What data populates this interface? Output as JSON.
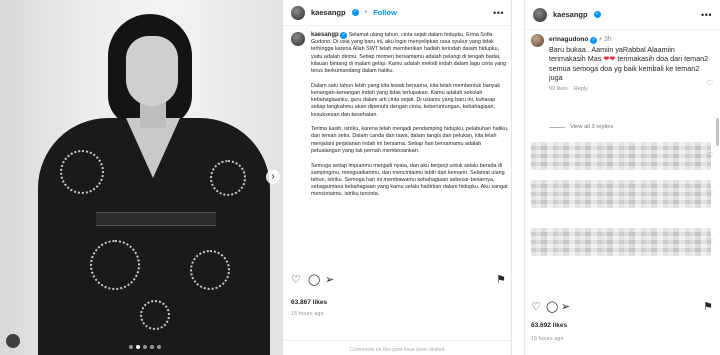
{
  "post_left": {
    "username": "kaesangp",
    "follow_label": "Follow",
    "more_label": "•••",
    "caption_username": "kaesangp",
    "caption_paragraphs": [
      "Selamat ulang tahun, cinta sejati dalam hidupku, Erina Sofia Gudono. Di usia yang baru ini, aku ingin menyelipkan rasa syukur yang tidak terhingga karena Allah SWT telah memberikan hadiah terindah dalam hidupku, yaitu adalah dirimu. Setiap momen bersamamu adalah pelangi di tengah badai, kilauan bintang di malam gelap. Kamu adalah melodi indah dalam lagu cinta yang terus berkumandang dalam hatiku.",
      "Dalam satu tahun lebih yang kita lewati bersama, kita telah membentuk banyak kenangan-kenangan indah yang tidak terlupakan. Kamu adalah sekolah kebahagiaanku, guru dalam arti cinta sejati. Di usiamu yang baru ini, kuharap setiap langkahmu akan dipenuhi dengan cinta, keberuntungan, kebahagiaan, kesuksesan dan kesehatan.",
      "Terima kasih, istriku, karena telah menjadi pendamping hidupku, pelabuhan hatiku, dan teman setia. Dalam canda dan tawa, dalam tangis dan pelukan, kita telah menjalani perjalanan indah ini bersama. Setiap hari bersamamu adalah petualangan yang tak pernah membosankan.",
      "Semoga setiap impianmu menjadi nyata, dan aku berjanji untuk selalu berada di sampingmu, menguatkanmu, dan mencintaimu lebih dari kemarin. Selamat ulang tahun, istriku. Semoga hari ini membawamu kebahagiaan sebesar-besarnya, sebagaimana kebahagiaan yang kamu selalu hadirkan dalam hidupku. Aku sangat mencintaimu, istriku tercinta."
    ],
    "likes": "63.867 likes",
    "time": "15 hours ago",
    "comments_off": "Comments on this post have been limited."
  },
  "post_right": {
    "username": "kaesangp",
    "more_label": "•••",
    "comment": {
      "username": "erinagudono",
      "age": "3h",
      "text": "Baru bukaa.. Aamiin yaRabbal Alaamiin terimakasih Mas",
      "hearts": "❤❤",
      "text2": "terimakasih doa dari teman2 semua semoga doa yg baik kembali ke teman2 juga",
      "likes": "99 likes",
      "reply_label": "Reply",
      "view_replies": "View all 3 replies"
    },
    "likes": "63.692 likes",
    "time": "15 hours ago"
  },
  "icons": {
    "heart": "heart-icon",
    "comment": "comment-icon",
    "share": "share-icon",
    "bookmark": "bookmark-icon",
    "more": "more-options-icon",
    "verified": "verified-badge-icon"
  },
  "colors": {
    "accent": "#0095f6",
    "heart": "#ed2b3f",
    "muted": "#8e8e8e"
  }
}
